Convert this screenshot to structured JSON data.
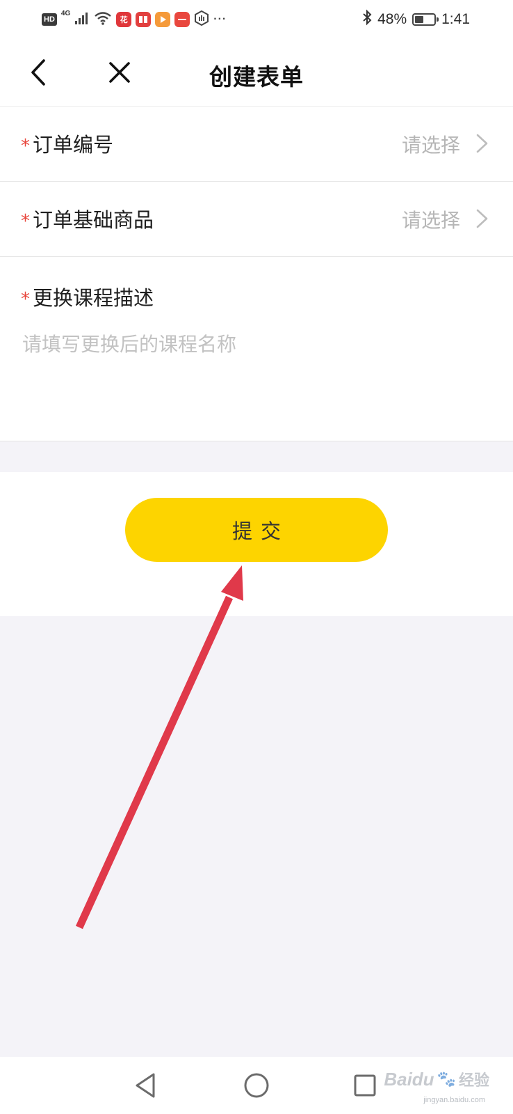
{
  "status_bar": {
    "hd": "HD",
    "network": "4G",
    "more": "···",
    "battery": "48%",
    "battery_level": 0.48,
    "time": "1:41",
    "app_icons": [
      {
        "name": "huabei-icon",
        "glyph": "花",
        "color": "#e0373b"
      },
      {
        "name": "reader-icon",
        "glyph": "▮",
        "color": "#e2403f"
      },
      {
        "name": "video-icon",
        "glyph": "▶",
        "color": "#f59a3a"
      },
      {
        "name": "huawei-store-icon",
        "glyph": "·",
        "color": "#e9473e"
      }
    ]
  },
  "header": {
    "title": "创建表单"
  },
  "form": {
    "required_mark": "*",
    "rows": [
      {
        "label": "订单编号",
        "value": "请选择"
      },
      {
        "label": "订单基础商品",
        "value": "请选择"
      }
    ],
    "description": {
      "label": "更换课程描述",
      "placeholder": "请填写更换后的课程名称"
    }
  },
  "submit": {
    "label": "提交"
  },
  "watermark": {
    "logo": "Baidu",
    "text": "经验",
    "sub": "jingyan.baidu.com"
  },
  "colors": {
    "accent": "#fdd400",
    "required": "#e8463c",
    "arrow": "#e0394a",
    "background": "#f4f3f8"
  }
}
